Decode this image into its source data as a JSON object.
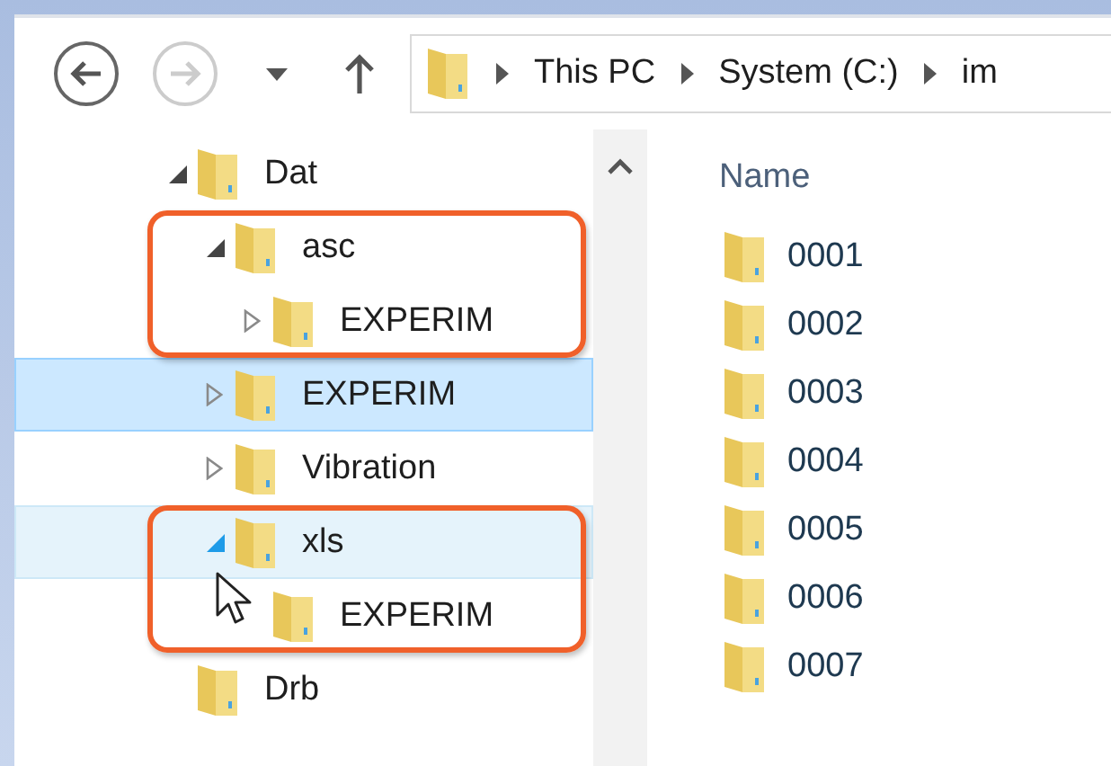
{
  "nav": {
    "buttons": [
      {
        "kind": "back",
        "disabled": false
      },
      {
        "kind": "forward",
        "disabled": true
      },
      {
        "kind": "recent",
        "disabled": false
      },
      {
        "kind": "up",
        "disabled": false
      }
    ]
  },
  "address_bar": {
    "crumbs": [
      "This PC",
      "System (C:)",
      "im"
    ]
  },
  "tree": {
    "items": [
      {
        "label": "Dat",
        "selected": false,
        "hovered": false,
        "highlighted": false,
        "expandable": true,
        "expanded": true,
        "children": [
          {
            "label": "asc",
            "selected": false,
            "hovered": false,
            "highlighted": true,
            "expandable": true,
            "expanded": true,
            "children": [
              {
                "label": "EXPERIM",
                "selected": false,
                "hovered": false,
                "highlighted": false,
                "expandable": true,
                "expanded": false
              }
            ]
          },
          {
            "label": "EXPERIM",
            "selected": true,
            "hovered": false,
            "highlighted": false,
            "expandable": true,
            "expanded": false
          },
          {
            "label": "Vibration",
            "selected": false,
            "hovered": false,
            "highlighted": false,
            "expandable": true,
            "expanded": false
          },
          {
            "label": "xls",
            "selected": false,
            "hovered": true,
            "highlighted": true,
            "expandable": true,
            "expanded": true,
            "children": [
              {
                "label": "EXPERIM",
                "selected": false,
                "hovered": false,
                "highlighted": false,
                "expandable": false
              }
            ]
          }
        ]
      },
      {
        "label": "Drb",
        "selected": false,
        "hovered": false,
        "highlighted": false,
        "expandable": false
      }
    ]
  },
  "file_list": {
    "columns": [
      "Name"
    ],
    "items": [
      "0001",
      "0002",
      "0003",
      "0004",
      "0005",
      "0006",
      "0007"
    ]
  }
}
